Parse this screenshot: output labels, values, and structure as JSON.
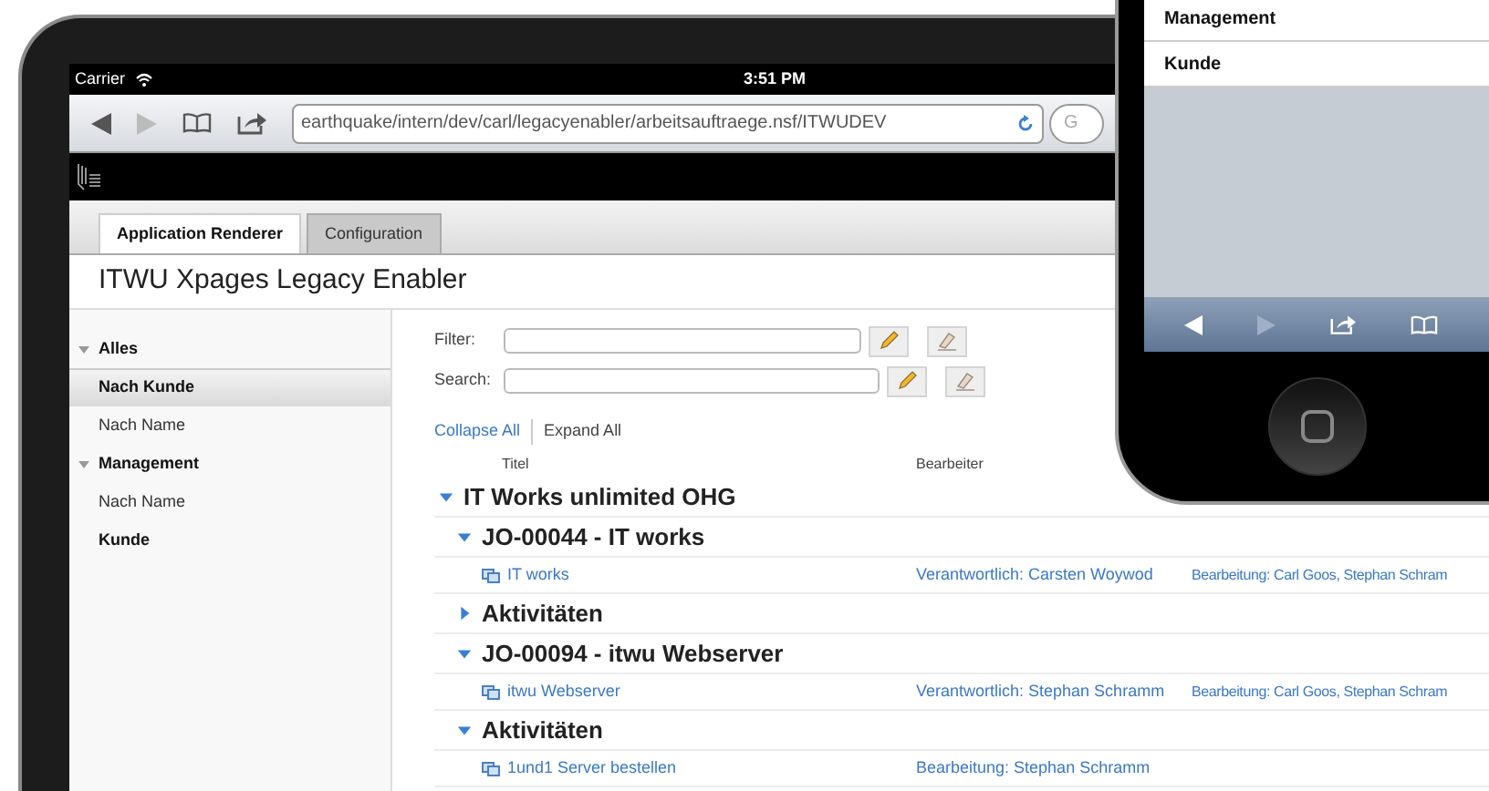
{
  "status_bar": {
    "carrier": "Carrier",
    "time": "3:51 PM"
  },
  "browser": {
    "url": "earthquake/intern/dev/carl/legacyenabler/arbeitsauftraege.nsf/ITWUDEV",
    "search_placeholder": "G"
  },
  "tabs": [
    {
      "label": "Application Renderer",
      "selected": true
    },
    {
      "label": "Configuration",
      "selected": false
    }
  ],
  "app_title": "ITWU Xpages Legacy Enabler",
  "sidebar": {
    "items": [
      {
        "label": "Alles",
        "expanded": true,
        "children": [
          {
            "label": "Nach Kunde",
            "selected": true
          },
          {
            "label": "Nach Name",
            "selected": false
          }
        ]
      },
      {
        "label": "Management",
        "expanded": true,
        "children": [
          {
            "label": "Nach Name",
            "selected": false
          }
        ]
      },
      {
        "label": "Kunde",
        "selected": false
      }
    ]
  },
  "filter": {
    "label": "Filter:"
  },
  "search": {
    "label": "Search:"
  },
  "view_links": [
    "Collapse All",
    "Expand All"
  ],
  "columns": [
    "Titel",
    "Bearbeiter"
  ],
  "rows": [
    {
      "kind": "category",
      "label": "IT Works unlimited OHG",
      "expanded": true,
      "children": [
        {
          "kind": "category",
          "label": "JO-00044 - IT works",
          "expanded": true,
          "children": [
            {
              "kind": "document",
              "label": "IT works",
              "cells": [
                "Verantwortlich: Carsten Woywod",
                "Bearbeitung: Carl Goos, Stephan Schram"
              ]
            }
          ]
        },
        {
          "kind": "category",
          "label": "Aktivitäten",
          "expanded": false
        },
        {
          "kind": "category",
          "label": "JO-00094 - itwu Webserver",
          "expanded": true,
          "children": [
            {
              "kind": "document",
              "label": "itwu Webserver",
              "cells": [
                "Verantwortlich: Stephan Schramm",
                "Bearbeitung: Carl Goos, Stephan Schram"
              ]
            }
          ]
        },
        {
          "kind": "category",
          "label": "Aktivitäten",
          "expanded": true,
          "children": [
            {
              "kind": "document",
              "label": "1und1 Server bestellen",
              "cells": [
                "Bearbeitung: Stephan Schramm"
              ]
            }
          ]
        }
      ]
    }
  ],
  "phone": {
    "items": [
      "Management",
      "Kunde"
    ]
  }
}
